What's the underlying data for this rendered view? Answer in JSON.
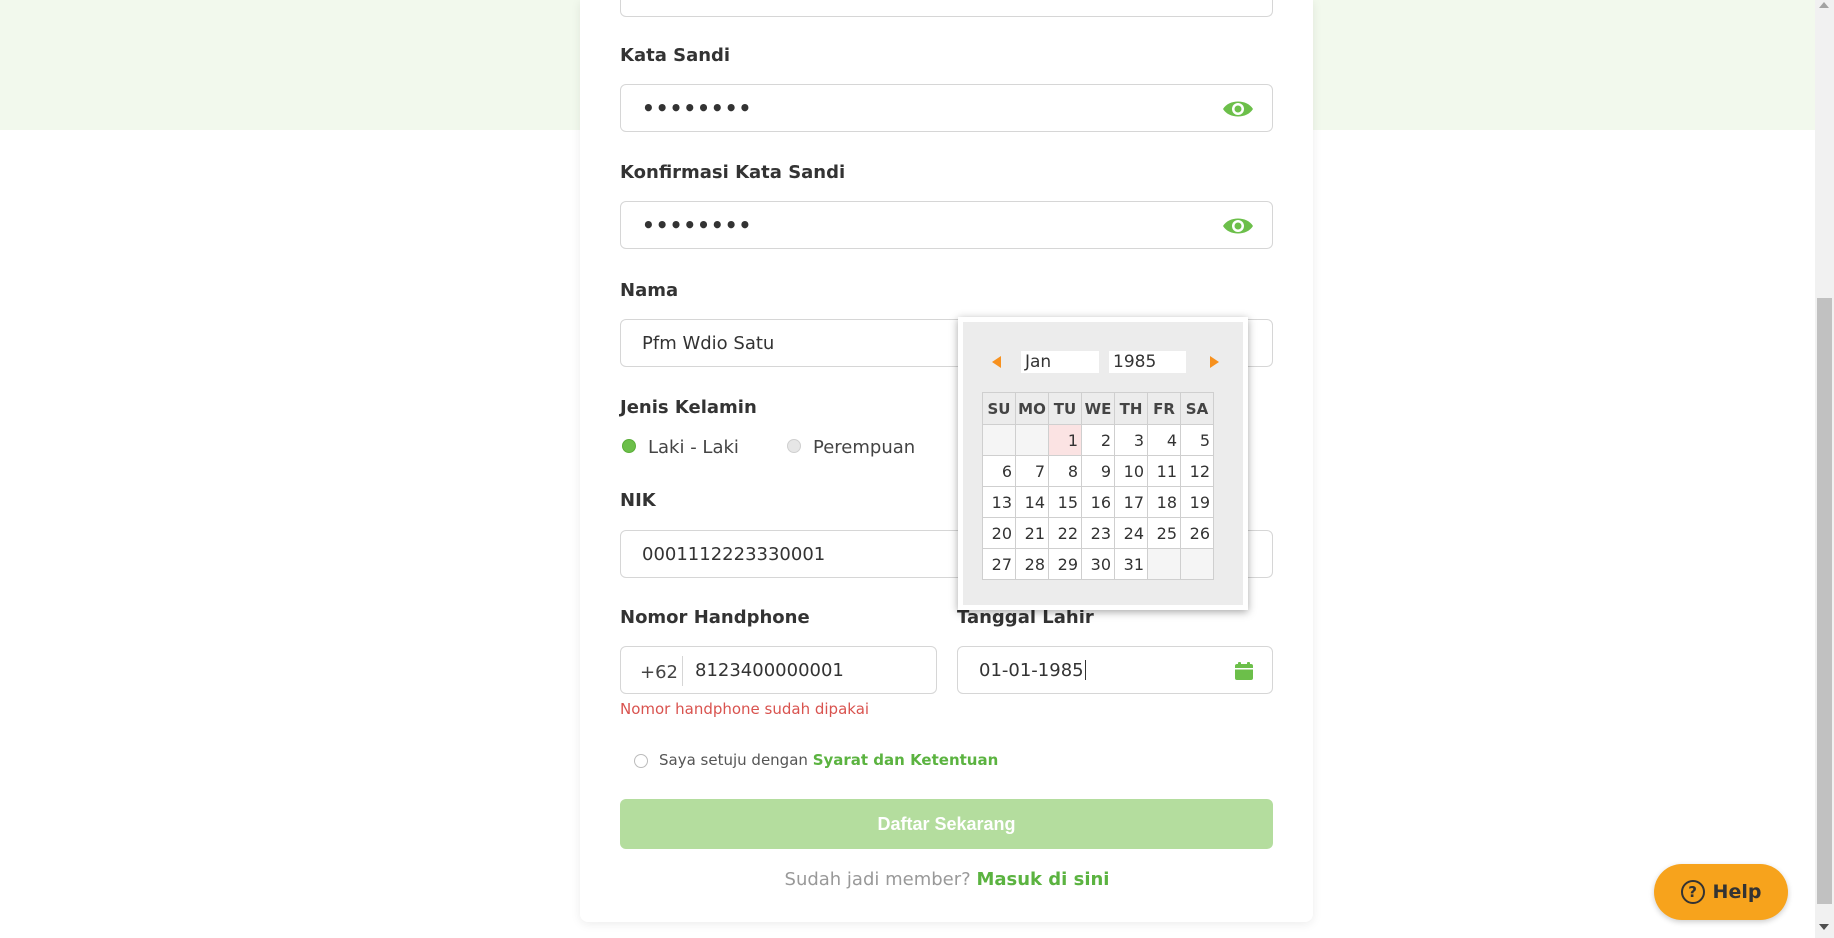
{
  "form": {
    "password_label": "Kata Sandi",
    "password_value": "••••••••",
    "confirm_label": "Konfirmasi Kata Sandi",
    "confirm_value": "••••••••",
    "name_label": "Nama",
    "name_value": "Pfm Wdio Satu",
    "gender_label": "Jenis Kelamin",
    "gender_male": "Laki - Laki",
    "gender_female": "Perempuan",
    "nik_label": "NIK",
    "nik_value": "0001112223330001",
    "phone_label": "Nomor Handphone",
    "phone_prefix": "+62",
    "phone_value": "8123400000001",
    "phone_error": "Nomor handphone sudah dipakai",
    "dob_label": "Tanggal Lahir",
    "dob_value": "01-01-1985",
    "agree_text": "Saya setuju dengan",
    "agree_link": "Syarat dan Ketentuan",
    "submit_label": "Daftar Sekarang",
    "login_text": "Sudah jadi member?",
    "login_link": "Masuk di sini"
  },
  "datepicker": {
    "month": "Jan",
    "year": "1985",
    "weekdays": [
      "SU",
      "MO",
      "TU",
      "WE",
      "TH",
      "FR",
      "SA"
    ],
    "weeks": [
      [
        "",
        "",
        "1",
        "2",
        "3",
        "4",
        "5"
      ],
      [
        "6",
        "7",
        "8",
        "9",
        "10",
        "11",
        "12"
      ],
      [
        "13",
        "14",
        "15",
        "16",
        "17",
        "18",
        "19"
      ],
      [
        "20",
        "21",
        "22",
        "23",
        "24",
        "25",
        "26"
      ],
      [
        "27",
        "28",
        "29",
        "30",
        "31",
        "",
        ""
      ]
    ],
    "selected_day": "1"
  },
  "help": {
    "label": "Help",
    "icon": "question-icon"
  },
  "colors": {
    "accent_green": "#6cbf4a",
    "error_red": "#d9534f",
    "help_orange": "#f7a31c",
    "button_disabled_green": "#b4dd9e"
  }
}
